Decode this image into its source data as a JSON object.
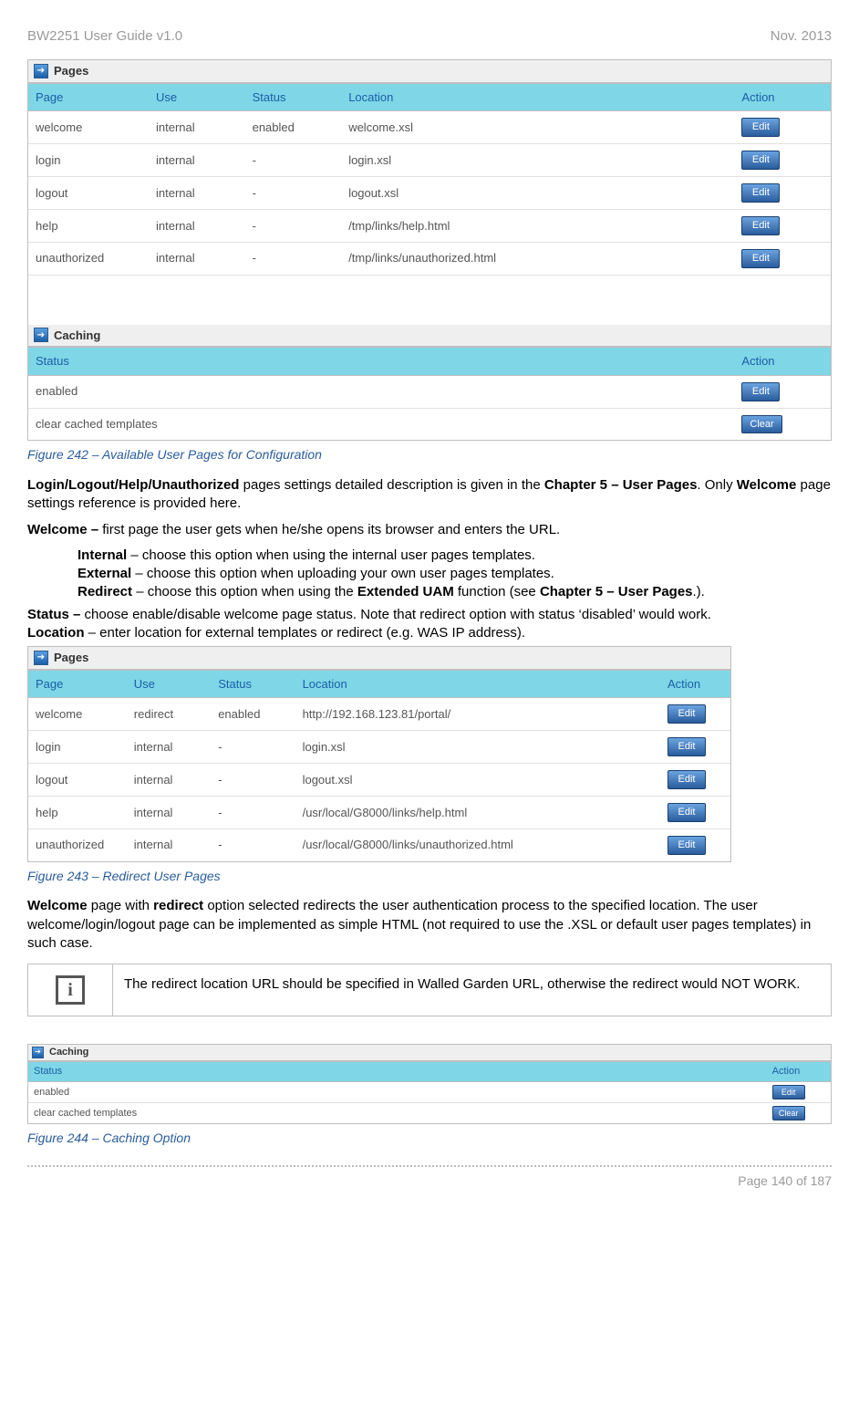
{
  "header": {
    "left": "BW2251 User Guide v1.0",
    "right": "Nov.  2013"
  },
  "fig242": {
    "sections": {
      "pages": {
        "title": "Pages",
        "headers": [
          "Page",
          "Use",
          "Status",
          "Location",
          "Action"
        ],
        "rows": [
          {
            "page": "welcome",
            "use": "internal",
            "status": "enabled",
            "location": "welcome.xsl",
            "action": "Edit"
          },
          {
            "page": "login",
            "use": "internal",
            "status": "-",
            "location": "login.xsl",
            "action": "Edit"
          },
          {
            "page": "logout",
            "use": "internal",
            "status": "-",
            "location": "logout.xsl",
            "action": "Edit"
          },
          {
            "page": "help",
            "use": "internal",
            "status": "-",
            "location": "/tmp/links/help.html",
            "action": "Edit"
          },
          {
            "page": "unauthorized",
            "use": "internal",
            "status": "-",
            "location": "/tmp/links/unauthorized.html",
            "action": "Edit"
          }
        ]
      },
      "caching": {
        "title": "Caching",
        "headers": [
          "Status",
          "Action"
        ],
        "rows": [
          {
            "status": "enabled",
            "action": "Edit"
          },
          {
            "status": "clear cached templates",
            "action": "Clear"
          }
        ]
      }
    },
    "caption": "Figure 242 – Available User Pages for Configuration"
  },
  "body": {
    "p1a": "Login/Logout/Help/Unauthorized",
    "p1b": " pages settings detailed description is given in the ",
    "p1c": "Chapter 5 – User Pages",
    "p1d": ". Only ",
    "p1e": "Welcome",
    "p1f": " page settings reference is provided here.",
    "p2a": "Welcome – ",
    "p2b": "first page the user gets when he/she opens its browser and enters the URL.",
    "l1a": "Internal",
    "l1b": " – choose this option when using the internal user pages templates.",
    "l2a": "External",
    "l2b": " – choose this option when uploading your own user pages templates.",
    "l3a": "Redirect",
    "l3b": " – choose this option when using the ",
    "l3c": "Extended UAM",
    "l3d": " function (see ",
    "l3e": "Chapter 5 – User Pages",
    "l3f": ".).",
    "p3a": "Status – ",
    "p3b": "choose enable/disable welcome page status. Note that redirect option with status ‘disabled’ would work.",
    "p4a": "Location",
    "p4b": " – enter location for external templates or redirect (e.g. WAS IP address)."
  },
  "fig243": {
    "title": "Pages",
    "headers": [
      "Page",
      "Use",
      "Status",
      "Location",
      "Action"
    ],
    "rows": [
      {
        "page": "welcome",
        "use": "redirect",
        "status": "enabled",
        "location": "http://192.168.123.81/portal/",
        "action": "Edit"
      },
      {
        "page": "login",
        "use": "internal",
        "status": "-",
        "location": "login.xsl",
        "action": "Edit"
      },
      {
        "page": "logout",
        "use": "internal",
        "status": "-",
        "location": "logout.xsl",
        "action": "Edit"
      },
      {
        "page": "help",
        "use": "internal",
        "status": "-",
        "location": "/usr/local/G8000/links/help.html",
        "action": "Edit"
      },
      {
        "page": "unauthorized",
        "use": "internal",
        "status": "-",
        "location": "/usr/local/G8000/links/unauthorized.html",
        "action": "Edit"
      }
    ],
    "caption": "Figure 243 – Redirect User Pages"
  },
  "body2": {
    "p5a": "Welcome",
    "p5b": " page with ",
    "p5c": "redirect",
    "p5d": " option selected redirects the user authentication process to the specified location. The user welcome/login/logout page can be implemented as simple HTML (not required to use the .XSL or default user pages templates) in such case.",
    "note": "The redirect location URL should be specified in Walled Garden URL, otherwise the redirect would NOT WORK."
  },
  "fig244": {
    "title": "Caching",
    "headers": [
      "Status",
      "Action"
    ],
    "rows": [
      {
        "status": "enabled",
        "action": "Edit"
      },
      {
        "status": "clear cached templates",
        "action": "Clear"
      }
    ],
    "caption": "Figure 244 – Caching Option"
  },
  "footer": "Page 140 of 187",
  "icons": {
    "info_glyph": "i",
    "arrow": "➔"
  }
}
